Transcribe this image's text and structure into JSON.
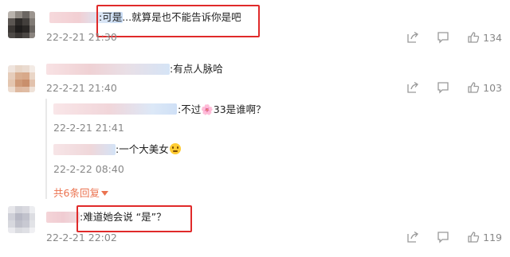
{
  "comments": [
    {
      "text": ":可是...就算是也不能告诉你是吧",
      "time": "22-2-21 21:30",
      "likes": "134"
    },
    {
      "text": ":有点人脉哈",
      "time": "22-2-21 21:40",
      "likes": "103",
      "replies": [
        {
          "text": ":不过🌸33是谁啊？",
          "time": "22-2-21 21:41"
        },
        {
          "text": ":一个大美女",
          "time": "22-2-22 08:40"
        }
      ],
      "more_label": "共6条回复"
    },
    {
      "text": ":难道她会说 “是”？",
      "time": "22-2-21 22:02",
      "likes": "119"
    }
  ],
  "colors": {
    "highlight": "#e02a2a",
    "link": "#eb7350",
    "muted": "#888888"
  },
  "icons": [
    "share-icon",
    "comment-icon",
    "like-icon",
    "reaction-emoji-icon"
  ]
}
